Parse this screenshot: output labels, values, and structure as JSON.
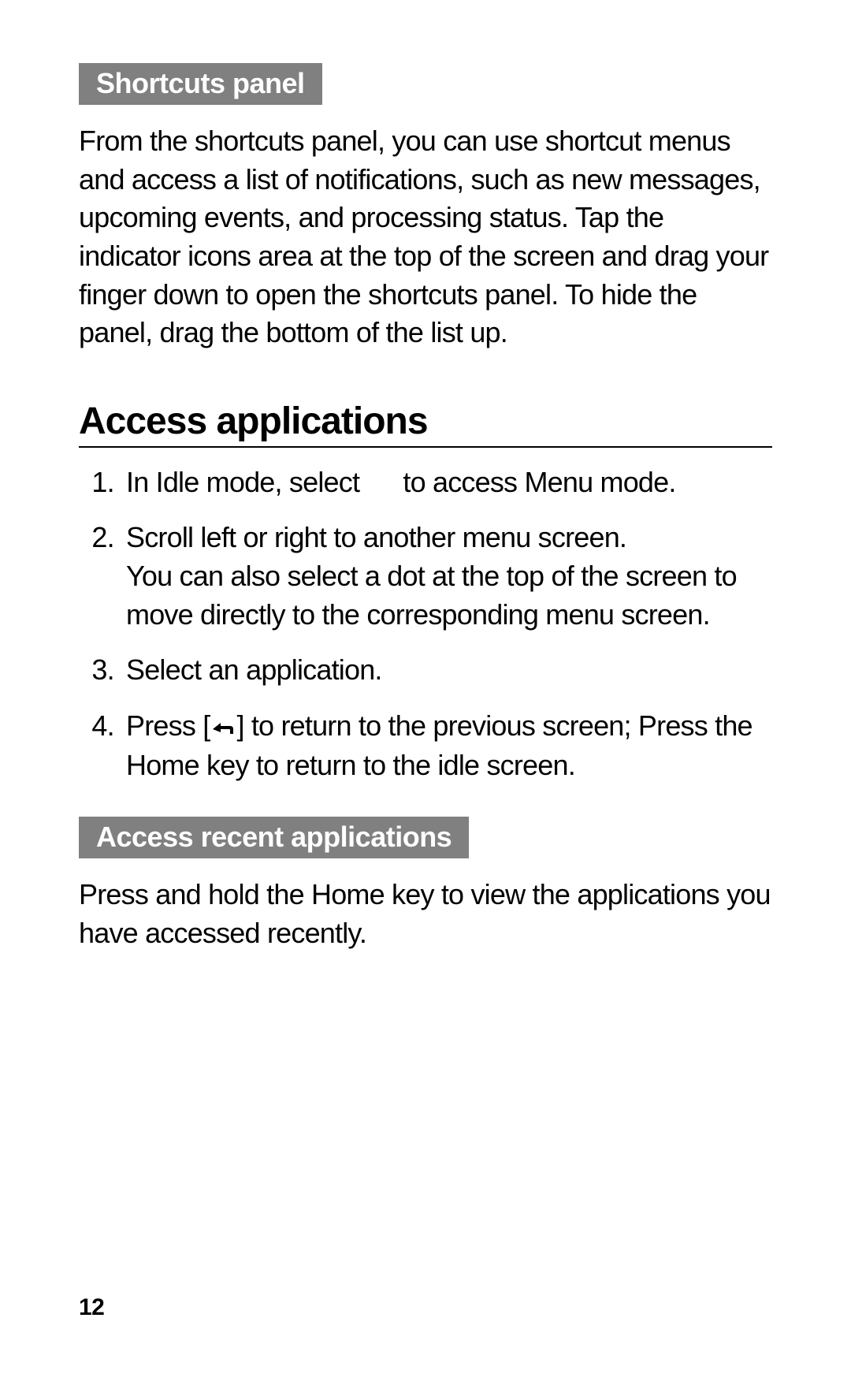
{
  "subhead1": "Shortcuts panel",
  "para1": "From the shortcuts panel, you can use shortcut menus and access a list of notifications, such as new messages, upcoming events, and processing status. Tap the indicator icons area at the top of the screen and drag your finger down to open the shortcuts panel. To hide the panel, drag the bottom of the list up.",
  "heading": "Access applications",
  "steps": {
    "s1a": "In Idle mode, select ",
    "s1b": " to access Menu mode.",
    "s2a": "Scroll left or right to another menu screen.",
    "s2b": "You can also select a dot at the top of the screen to move directly to the corresponding menu screen.",
    "s3": "Select an application.",
    "s4a": "Press [",
    "s4b": "] to return to the previous screen; Press the Home key to return to the idle screen."
  },
  "subhead2": "Access recent applications",
  "para2": "Press and hold the Home key to view the applications you have accessed recently.",
  "pageNumber": "12"
}
